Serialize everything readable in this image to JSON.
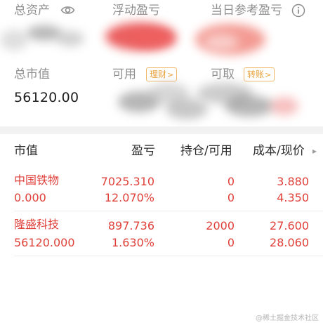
{
  "summary": {
    "total_assets_label": "总资产",
    "floating_pl_label": "浮动盈亏",
    "today_pl_label": "当日参考盈亏",
    "market_value_label": "总市值",
    "market_value": "56120.00",
    "available_label": "可用",
    "withdrawable_label": "可取",
    "wealth_tag": "理财",
    "transfer_tag": "转账",
    "tag_chevron": ">"
  },
  "table": {
    "headers": {
      "market_value": "市值",
      "pl": "盈亏",
      "position": "持仓/可用",
      "cost_price": "成本/现价",
      "more": "▸"
    },
    "rows": [
      {
        "name": "中国铁物",
        "market_value": "0.000",
        "pl": "7025.310",
        "pl_pct": "12.070%",
        "position": "0",
        "available": "0",
        "cost": "3.880",
        "price": "4.350"
      },
      {
        "name": "隆盛科技",
        "market_value": "56120.000",
        "pl": "897.736",
        "pl_pct": "1.630%",
        "position": "2000",
        "available": "0",
        "cost": "27.600",
        "price": "28.060"
      }
    ]
  },
  "watermark": "@稀土掘金技术社区",
  "colors": {
    "gain": "#e0403a",
    "tag": "#e8a33d",
    "label": "#8f8f8f"
  }
}
